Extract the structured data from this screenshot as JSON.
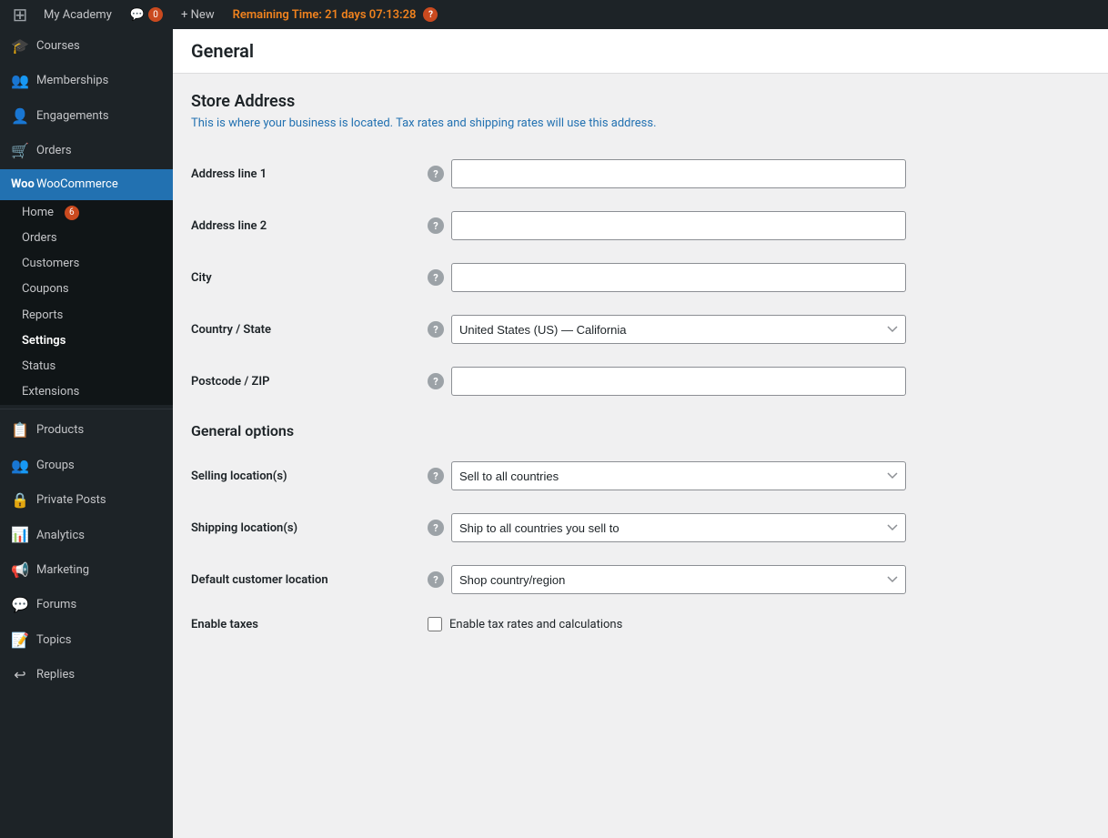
{
  "adminBar": {
    "logo": "W",
    "site": "My Academy",
    "comments": "0",
    "new": "+ New",
    "timer": "Remaining Time: 21 days 07:13:28",
    "help": "?"
  },
  "sidebar": {
    "topItems": [
      {
        "id": "courses",
        "label": "Courses",
        "icon": "🎓"
      },
      {
        "id": "memberships",
        "label": "Memberships",
        "icon": "👥"
      },
      {
        "id": "engagements",
        "label": "Engagements",
        "icon": "👤"
      },
      {
        "id": "orders",
        "label": "Orders",
        "icon": "🛒"
      }
    ],
    "woocommerce": {
      "label": "WooCommerce",
      "badge": "",
      "subItems": [
        {
          "id": "home",
          "label": "Home",
          "badge": "6"
        },
        {
          "id": "orders",
          "label": "Orders"
        },
        {
          "id": "customers",
          "label": "Customers"
        },
        {
          "id": "coupons",
          "label": "Coupons"
        },
        {
          "id": "reports",
          "label": "Reports"
        },
        {
          "id": "settings",
          "label": "Settings",
          "active": true
        },
        {
          "id": "status",
          "label": "Status"
        },
        {
          "id": "extensions",
          "label": "Extensions"
        }
      ]
    },
    "bottomItems": [
      {
        "id": "products",
        "label": "Products",
        "icon": "📋"
      },
      {
        "id": "groups",
        "label": "Groups",
        "icon": "👥"
      },
      {
        "id": "private-posts",
        "label": "Private Posts",
        "icon": "🔒"
      },
      {
        "id": "analytics",
        "label": "Analytics",
        "icon": "📊"
      },
      {
        "id": "marketing",
        "label": "Marketing",
        "icon": "📢"
      },
      {
        "id": "forums",
        "label": "Forums",
        "icon": "💬"
      },
      {
        "id": "topics",
        "label": "Topics",
        "icon": "📝"
      },
      {
        "id": "replies",
        "label": "Replies",
        "icon": "↩"
      }
    ]
  },
  "content": {
    "pageTitle": "General",
    "storeAddress": {
      "title": "Store Address",
      "description": "This is where your business is located. Tax rates and shipping rates will use this address.",
      "fields": [
        {
          "id": "address1",
          "label": "Address line 1",
          "type": "text",
          "value": ""
        },
        {
          "id": "address2",
          "label": "Address line 2",
          "type": "text",
          "value": ""
        },
        {
          "id": "city",
          "label": "City",
          "type": "text",
          "value": ""
        },
        {
          "id": "country",
          "label": "Country / State",
          "type": "select",
          "value": "United States (US) — California"
        },
        {
          "id": "postcode",
          "label": "Postcode / ZIP",
          "type": "text",
          "value": ""
        }
      ]
    },
    "generalOptions": {
      "title": "General options",
      "fields": [
        {
          "id": "selling-locations",
          "label": "Selling location(s)",
          "type": "select",
          "value": "Sell to all countries"
        },
        {
          "id": "shipping-locations",
          "label": "Shipping location(s)",
          "type": "select",
          "value": "Ship to all countries you sell to"
        },
        {
          "id": "default-customer",
          "label": "Default customer location",
          "type": "select",
          "value": "Shop country/region"
        },
        {
          "id": "enable-taxes",
          "label": "Enable taxes",
          "type": "checkbox",
          "checkboxLabel": "Enable tax rates and calculations"
        }
      ]
    }
  }
}
